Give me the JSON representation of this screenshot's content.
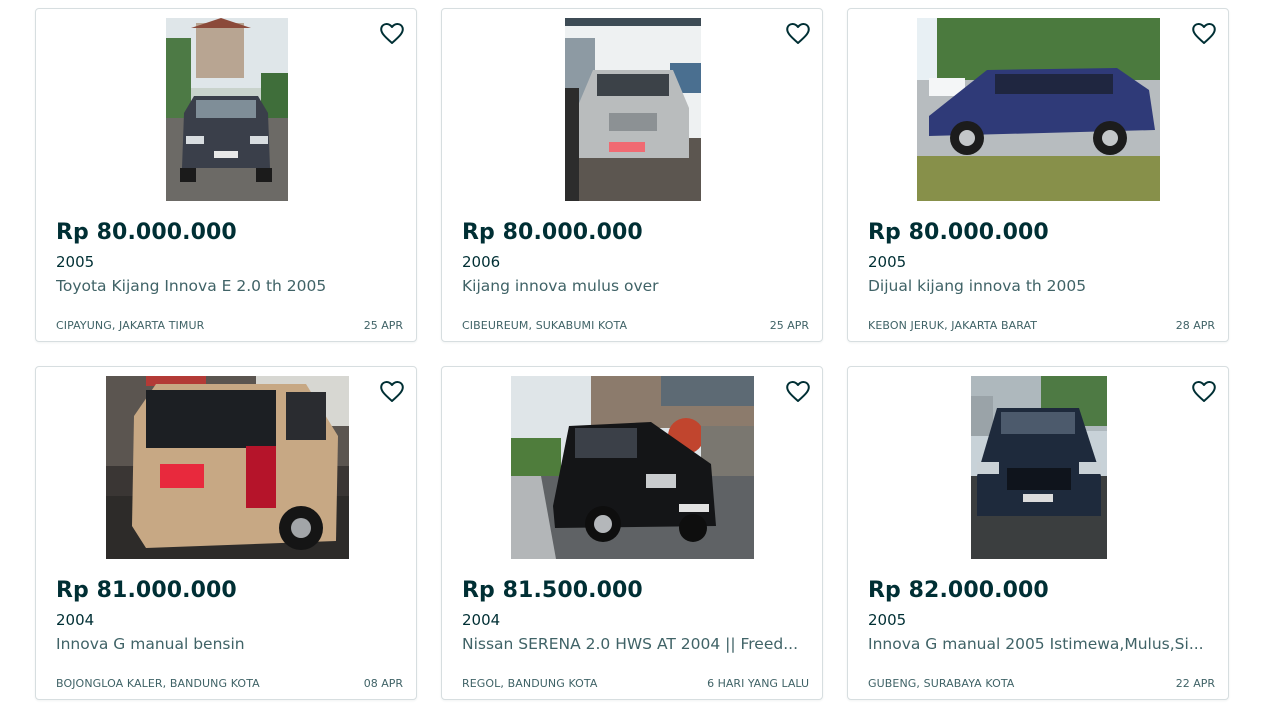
{
  "listings": [
    {
      "price": "Rp 80.000.000",
      "year": "2005",
      "title": "Toyota Kijang Innova E 2.0 th 2005",
      "location": "CIPAYUNG, JAKARTA TIMUR",
      "date": "25 APR",
      "photo": "dark-gray-minivan-front"
    },
    {
      "price": "Rp 80.000.000",
      "year": "2006",
      "title": "Kijang innova mulus over",
      "location": "CIBEUREUM, SUKABUMI KOTA",
      "date": "25 APR",
      "photo": "silver-minivan-front"
    },
    {
      "price": "Rp 80.000.000",
      "year": "2005",
      "title": "Dijual kijang innova th 2005",
      "location": "KEBON JERUK, JAKARTA BARAT",
      "date": "28 APR",
      "photo": "blue-minivan-side"
    },
    {
      "price": "Rp 81.000.000",
      "year": "2004",
      "title": "Innova G manual bensin",
      "location": "BOJONGLOA KALER, BANDUNG KOTA",
      "date": "08 APR",
      "photo": "gold-minivan-rear"
    },
    {
      "price": "Rp 81.500.000",
      "year": "2004",
      "title": "Nissan SERENA 2.0 HWS AT 2004 || Freed...",
      "location": "REGOL, BANDUNG KOTA",
      "date": "6 HARI YANG LALU",
      "photo": "black-minivan-street"
    },
    {
      "price": "Rp 82.000.000",
      "year": "2005",
      "title": "Innova G manual 2005 Istimewa,Mulus,Si...",
      "location": "GUBENG, SURABAYA KOTA",
      "date": "22 APR",
      "photo": "dark-minivan-front"
    }
  ],
  "icons": {
    "favorite": "heart-outline-icon"
  },
  "colors": {
    "price_text": "#002f34",
    "secondary_text": "#406367",
    "card_border": "#d7dee0"
  }
}
